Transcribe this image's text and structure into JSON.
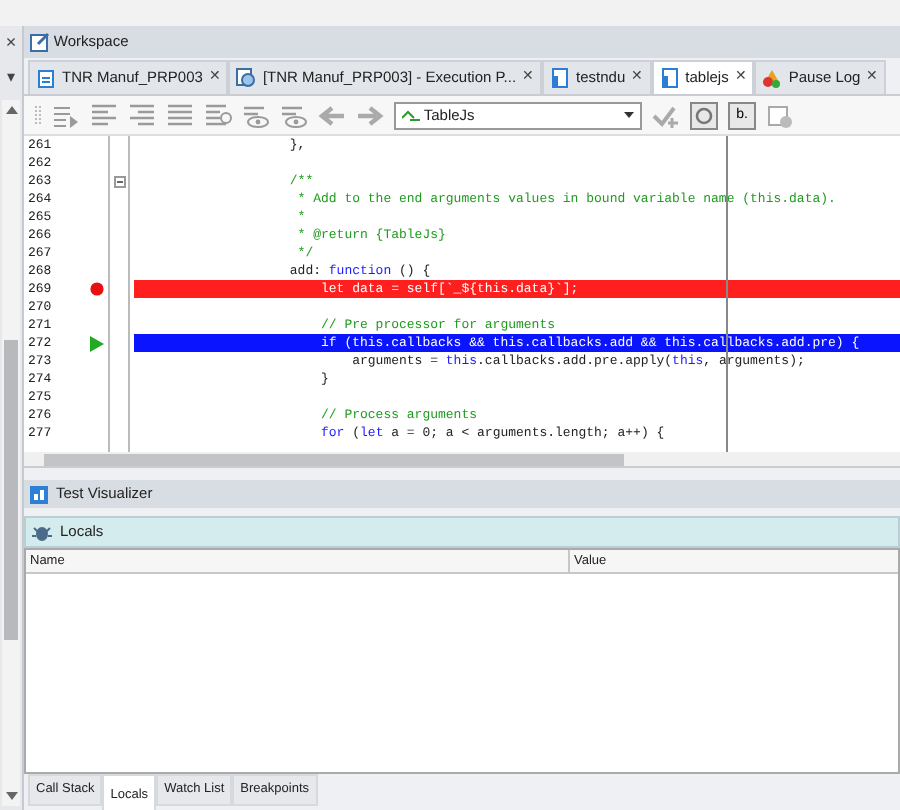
{
  "left_panel": {
    "close": "×",
    "menu": "▾"
  },
  "workspace": {
    "title": "Workspace"
  },
  "tabs": [
    {
      "label": "TNR Manuf_PRP003",
      "selected": false,
      "close": "✕"
    },
    {
      "label": "[TNR Manuf_PRP003] - Execution P...",
      "selected": false,
      "close": "✕"
    },
    {
      "label": "testndu",
      "selected": false,
      "close": "✕"
    },
    {
      "label": "tablejs",
      "selected": true,
      "close": "✕"
    },
    {
      "label": "Pause Log",
      "selected": false,
      "close": "✕"
    }
  ],
  "toolbar": {
    "dropdown": "TableJs",
    "b_button": "b."
  },
  "editor": {
    "lines": [
      {
        "number": "261",
        "kind": "normal",
        "fold": false,
        "tokens": [
          {
            "text": "                    },",
            "kind": "plain"
          }
        ]
      },
      {
        "number": "262",
        "kind": "normal",
        "fold": false
      },
      {
        "number": "263",
        "kind": "normal",
        "fold": true,
        "tokens": [
          {
            "text": "                    /**",
            "kind": "comment"
          }
        ]
      },
      {
        "number": "264",
        "kind": "normal",
        "fold": false,
        "tokens": [
          {
            "text": "                     * Add to the end arguments values in bound variable name (this.data).",
            "kind": "comment"
          }
        ]
      },
      {
        "number": "265",
        "kind": "normal",
        "fold": false,
        "tokens": [
          {
            "text": "                     *",
            "kind": "comment"
          }
        ]
      },
      {
        "number": "266",
        "kind": "normal",
        "fold": false,
        "tokens": [
          {
            "text": "                     * @return {TableJs}",
            "kind": "comment"
          }
        ]
      },
      {
        "number": "267",
        "kind": "normal",
        "fold": false,
        "tokens": [
          {
            "text": "                     */",
            "kind": "comment"
          }
        ]
      },
      {
        "number": "268",
        "kind": "normal",
        "fold": false,
        "tokens": [
          {
            "text": "                    add: ",
            "kind": "plain"
          },
          {
            "text": "function",
            "kind": "keyword"
          },
          {
            "text": " () {",
            "kind": "plain"
          }
        ]
      },
      {
        "number": "269",
        "kind": "breakpoint",
        "fold": false,
        "tokens": [
          {
            "text": "                        let data = self[`_${this.data}`];",
            "kind": "plain"
          }
        ]
      },
      {
        "number": "270",
        "kind": "normal",
        "fold": false
      },
      {
        "number": "271",
        "kind": "normal",
        "fold": false,
        "tokens": [
          {
            "text": "                        // Pre processor for arguments",
            "kind": "comment"
          }
        ]
      },
      {
        "number": "272",
        "kind": "current",
        "fold": false,
        "tokens": [
          {
            "text": "                        if (this.callbacks && this.callbacks.add && this.callbacks.add.pre) {",
            "kind": "plain"
          }
        ]
      },
      {
        "number": "273",
        "kind": "normal",
        "fold": false,
        "tokens": [
          {
            "text": "                            arguments = ",
            "kind": "plain"
          },
          {
            "text": "this",
            "kind": "keyword"
          },
          {
            "text": ".callbacks.add.pre.apply(",
            "kind": "plain"
          },
          {
            "text": "this",
            "kind": "keyword"
          },
          {
            "text": ", arguments);",
            "kind": "plain"
          }
        ]
      },
      {
        "number": "274",
        "kind": "normal",
        "fold": false,
        "tokens": [
          {
            "text": "                        }",
            "kind": "plain"
          }
        ]
      },
      {
        "number": "275",
        "kind": "normal",
        "fold": false
      },
      {
        "number": "276",
        "kind": "normal",
        "fold": false,
        "tokens": [
          {
            "text": "                        // Process arguments",
            "kind": "comment"
          }
        ]
      },
      {
        "number": "277",
        "kind": "normal",
        "fold": false,
        "tokens": [
          {
            "text": "                        for",
            "kind": "keyword"
          },
          {
            "text": " (",
            "kind": "plain"
          },
          {
            "text": "let",
            "kind": "keyword"
          },
          {
            "text": " a = 0; a < arguments.length; a++) {",
            "kind": "plain"
          }
        ]
      }
    ]
  },
  "test_visualizer": {
    "title": "Test Visualizer"
  },
  "locals": {
    "title": "Locals",
    "columns": [
      "Name",
      "Value"
    ]
  },
  "bottom_tabs": [
    {
      "label": "Call Stack",
      "selected": false
    },
    {
      "label": "Locals",
      "selected": true
    },
    {
      "label": "Watch List",
      "selected": false
    },
    {
      "label": "Breakpoints",
      "selected": false
    }
  ]
}
